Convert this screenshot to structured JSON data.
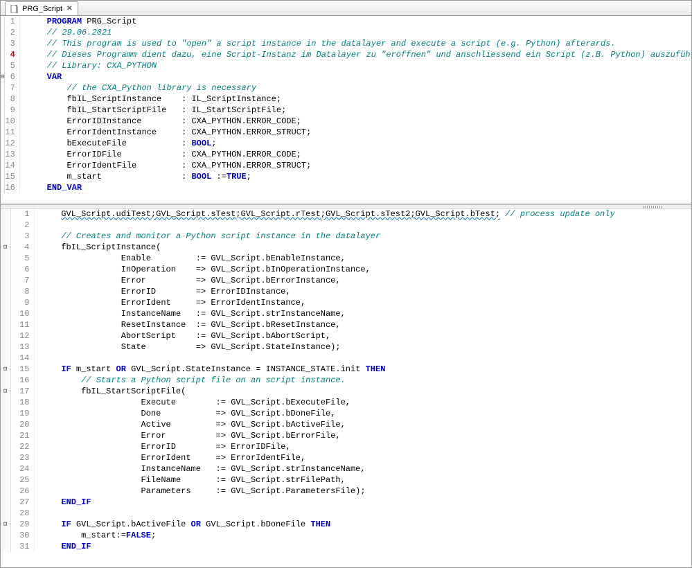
{
  "tab": {
    "title": "PRG_Script",
    "close": "✕"
  },
  "top": {
    "lines": [
      {
        "n": 1,
        "fold": "",
        "cls": "",
        "html": [
          [
            "    ",
            ""
          ],
          [
            "PROGRAM",
            "kw"
          ],
          [
            " PRG_Script",
            ""
          ]
        ]
      },
      {
        "n": 2,
        "fold": "",
        "cls": "",
        "html": [
          [
            "    ",
            ""
          ],
          [
            "// 29.06.2021",
            "cm"
          ]
        ]
      },
      {
        "n": 3,
        "fold": "",
        "cls": "",
        "html": [
          [
            "    ",
            ""
          ],
          [
            "// This program is used to \"open\" a script instance in the datalayer and execute a script (e.g. Python) afterards.",
            "cm"
          ]
        ]
      },
      {
        "n": 4,
        "fold": "",
        "cls": "err",
        "html": [
          [
            "    ",
            ""
          ],
          [
            "// Dieses Programm dient dazu, eine Script-Instanz im Datalayer zu \"eröffnen\" und anschliessend ein Script (z.B. Python) auszuführen.",
            "cm"
          ]
        ]
      },
      {
        "n": 5,
        "fold": "",
        "cls": "",
        "html": [
          [
            "    ",
            ""
          ],
          [
            "// Library: CXA_PYTHON",
            "cm"
          ]
        ]
      },
      {
        "n": 6,
        "fold": "⊟",
        "cls": "",
        "html": [
          [
            "    ",
            ""
          ],
          [
            "VAR",
            "kw"
          ]
        ]
      },
      {
        "n": 7,
        "fold": "",
        "cls": "",
        "html": [
          [
            "        ",
            ""
          ],
          [
            "// the CXA_Python library is necessary",
            "cm"
          ]
        ]
      },
      {
        "n": 8,
        "fold": "",
        "cls": "",
        "html": [
          [
            "        fbIL_ScriptInstance    : IL_ScriptInstance;",
            ""
          ]
        ]
      },
      {
        "n": 9,
        "fold": "",
        "cls": "",
        "html": [
          [
            "        fbIL_StartScriptFile   : IL_StartScriptFile;",
            ""
          ]
        ]
      },
      {
        "n": 10,
        "fold": "",
        "cls": "",
        "html": [
          [
            "        ErrorIDInstance        : CXA_PYTHON.ERROR_CODE;",
            ""
          ]
        ]
      },
      {
        "n": 11,
        "fold": "",
        "cls": "",
        "html": [
          [
            "        ErrorIdentInstance     : CXA_PYTHON.ERROR_STRUCT;",
            ""
          ]
        ]
      },
      {
        "n": 12,
        "fold": "",
        "cls": "",
        "html": [
          [
            "        bExecuteFile           : ",
            ""
          ],
          [
            "BOOL",
            "kw"
          ],
          [
            ";",
            ""
          ]
        ]
      },
      {
        "n": 13,
        "fold": "",
        "cls": "",
        "html": [
          [
            "        ErrorIDFile            : CXA_PYTHON.ERROR_CODE;",
            ""
          ]
        ]
      },
      {
        "n": 14,
        "fold": "",
        "cls": "",
        "html": [
          [
            "        ErrorIdentFile         : CXA_PYTHON.ERROR_STRUCT;",
            ""
          ]
        ]
      },
      {
        "n": 15,
        "fold": "",
        "cls": "",
        "html": [
          [
            "        m_start                : ",
            ""
          ],
          [
            "BOOL",
            "kw"
          ],
          [
            " :=",
            ""
          ],
          [
            "TRUE",
            "kw"
          ],
          [
            ";",
            ""
          ]
        ]
      },
      {
        "n": 16,
        "fold": "",
        "cls": "",
        "html": [
          [
            "    ",
            ""
          ],
          [
            "END_VAR",
            "kw"
          ]
        ]
      }
    ]
  },
  "bottom": {
    "lines": [
      {
        "n": 1,
        "fold": "",
        "cls": "",
        "html": [
          [
            "    ",
            ""
          ],
          [
            "GVL_Script.udiTest;GVL_Script.sTest;GVL_Script.rTest;GVL_Script.sTest2;GVL_Script.bTest;",
            "wavy"
          ],
          [
            " ",
            ""
          ],
          [
            "// process update only",
            "cm"
          ]
        ]
      },
      {
        "n": 2,
        "fold": "",
        "cls": "",
        "html": [
          [
            "",
            ""
          ]
        ]
      },
      {
        "n": 3,
        "fold": "",
        "cls": "",
        "html": [
          [
            "    ",
            ""
          ],
          [
            "// Creates and monitor a Python script instance in the datalayer",
            "cm"
          ]
        ]
      },
      {
        "n": 4,
        "fold": "⊟",
        "cls": "",
        "html": [
          [
            "    fbIL_ScriptInstance(",
            ""
          ]
        ]
      },
      {
        "n": 5,
        "fold": "",
        "cls": "",
        "html": [
          [
            "                Enable         := GVL_Script.bEnableInstance,",
            ""
          ]
        ]
      },
      {
        "n": 6,
        "fold": "",
        "cls": "",
        "html": [
          [
            "                InOperation    => GVL_Script.bInOperationInstance,",
            ""
          ]
        ]
      },
      {
        "n": 7,
        "fold": "",
        "cls": "",
        "html": [
          [
            "                Error          => GVL_Script.bErrorInstance,",
            ""
          ]
        ]
      },
      {
        "n": 8,
        "fold": "",
        "cls": "",
        "html": [
          [
            "                ErrorID        => ErrorIDInstance,",
            ""
          ]
        ]
      },
      {
        "n": 9,
        "fold": "",
        "cls": "",
        "html": [
          [
            "                ErrorIdent     => ErrorIdentInstance,",
            ""
          ]
        ]
      },
      {
        "n": 10,
        "fold": "",
        "cls": "",
        "html": [
          [
            "                InstanceName   := GVL_Script.strInstanceName,",
            ""
          ]
        ]
      },
      {
        "n": 11,
        "fold": "",
        "cls": "",
        "html": [
          [
            "                ResetInstance  := GVL_Script.bResetInstance,",
            ""
          ]
        ]
      },
      {
        "n": 12,
        "fold": "",
        "cls": "",
        "html": [
          [
            "                AbortScript    := GVL_Script.bAbortScript,",
            ""
          ]
        ]
      },
      {
        "n": 13,
        "fold": "",
        "cls": "",
        "html": [
          [
            "                State          => GVL_Script.StateInstance);",
            ""
          ]
        ]
      },
      {
        "n": 14,
        "fold": "",
        "cls": "",
        "html": [
          [
            "",
            ""
          ]
        ]
      },
      {
        "n": 15,
        "fold": "⊟",
        "cls": "",
        "html": [
          [
            "    ",
            ""
          ],
          [
            "IF",
            "kw"
          ],
          [
            " m_start ",
            ""
          ],
          [
            "OR",
            "kw"
          ],
          [
            " GVL_Script.StateInstance = INSTANCE_STATE.init ",
            ""
          ],
          [
            "THEN",
            "kw"
          ]
        ]
      },
      {
        "n": 16,
        "fold": "",
        "cls": "",
        "html": [
          [
            "        ",
            ""
          ],
          [
            "// Starts a Python script file on an script instance.",
            "cm"
          ]
        ]
      },
      {
        "n": 17,
        "fold": "⊟",
        "cls": "",
        "html": [
          [
            "        fbIL_StartScriptFile(",
            ""
          ]
        ]
      },
      {
        "n": 18,
        "fold": "",
        "cls": "",
        "html": [
          [
            "                    Execute        := GVL_Script.bExecuteFile,",
            ""
          ]
        ]
      },
      {
        "n": 19,
        "fold": "",
        "cls": "",
        "html": [
          [
            "                    Done           => GVL_Script.bDoneFile,",
            ""
          ]
        ]
      },
      {
        "n": 20,
        "fold": "",
        "cls": "",
        "html": [
          [
            "                    Active         => GVL_Script.bActiveFile,",
            ""
          ]
        ]
      },
      {
        "n": 21,
        "fold": "",
        "cls": "",
        "html": [
          [
            "                    Error          => GVL_Script.bErrorFile,",
            ""
          ]
        ]
      },
      {
        "n": 22,
        "fold": "",
        "cls": "",
        "html": [
          [
            "                    ErrorID        => ErrorIDFile,",
            ""
          ]
        ]
      },
      {
        "n": 23,
        "fold": "",
        "cls": "",
        "html": [
          [
            "                    ErrorIdent     => ErrorIdentFile,",
            ""
          ]
        ]
      },
      {
        "n": 24,
        "fold": "",
        "cls": "",
        "html": [
          [
            "                    InstanceName   := GVL_Script.strInstanceName,",
            ""
          ]
        ]
      },
      {
        "n": 25,
        "fold": "",
        "cls": "",
        "html": [
          [
            "                    FileName       := GVL_Script.strFilePath,",
            ""
          ]
        ]
      },
      {
        "n": 26,
        "fold": "",
        "cls": "",
        "html": [
          [
            "                    Parameters     := GVL_Script.ParametersFile);",
            ""
          ]
        ]
      },
      {
        "n": 27,
        "fold": "",
        "cls": "",
        "html": [
          [
            "    ",
            ""
          ],
          [
            "END_IF",
            "kw"
          ]
        ]
      },
      {
        "n": 28,
        "fold": "",
        "cls": "",
        "html": [
          [
            "",
            ""
          ]
        ]
      },
      {
        "n": 29,
        "fold": "⊟",
        "cls": "",
        "html": [
          [
            "    ",
            ""
          ],
          [
            "IF",
            "kw"
          ],
          [
            " GVL_Script.bActiveFile ",
            ""
          ],
          [
            "OR",
            "kw"
          ],
          [
            " GVL_Script.bDoneFile ",
            ""
          ],
          [
            "THEN",
            "kw"
          ]
        ]
      },
      {
        "n": 30,
        "fold": "",
        "cls": "",
        "html": [
          [
            "        m_start:=",
            ""
          ],
          [
            "FALSE",
            "kw"
          ],
          [
            ";",
            ""
          ]
        ]
      },
      {
        "n": 31,
        "fold": "",
        "cls": "",
        "html": [
          [
            "    ",
            ""
          ],
          [
            "END_IF",
            "kw"
          ]
        ]
      }
    ]
  }
}
